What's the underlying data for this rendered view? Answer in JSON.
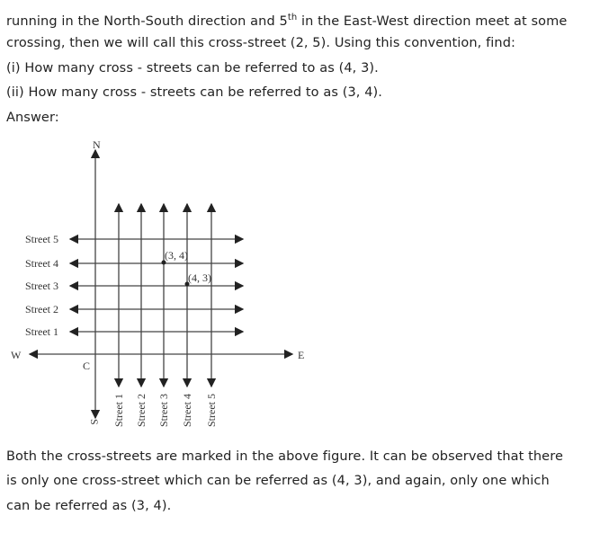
{
  "question": {
    "line1_a": "running in the North-South direction and 5",
    "line1_sup": "th",
    "line1_b": " in the East-West direction meet at some",
    "line2": "crossing, then we will call this cross-street (2, 5). Using this convention, find:",
    "line3": "(i) How many cross - streets can be referred to as (4, 3).",
    "line4": "(ii) How many cross - streets can be referred to as (3, 4).",
    "answer_label": "Answer:"
  },
  "figure": {
    "north": "N",
    "south": "S",
    "west": "W",
    "east": "E",
    "origin": "C",
    "east_west_streets": [
      "Street 1",
      "Street 2",
      "Street 3",
      "Street 4",
      "Street 5"
    ],
    "north_south_streets": [
      "Street 1",
      "Street 2",
      "Street 3",
      "Street 4",
      "Street 5"
    ],
    "point_a": "(3, 4)",
    "point_b": "(4, 3)"
  },
  "conclusion": {
    "line1": "Both the cross-streets are marked in the above figure. It can be observed that there",
    "line2": "is only one cross-street which can be referred as (4, 3), and again, only one which",
    "line3": "can be referred as (3, 4)."
  }
}
